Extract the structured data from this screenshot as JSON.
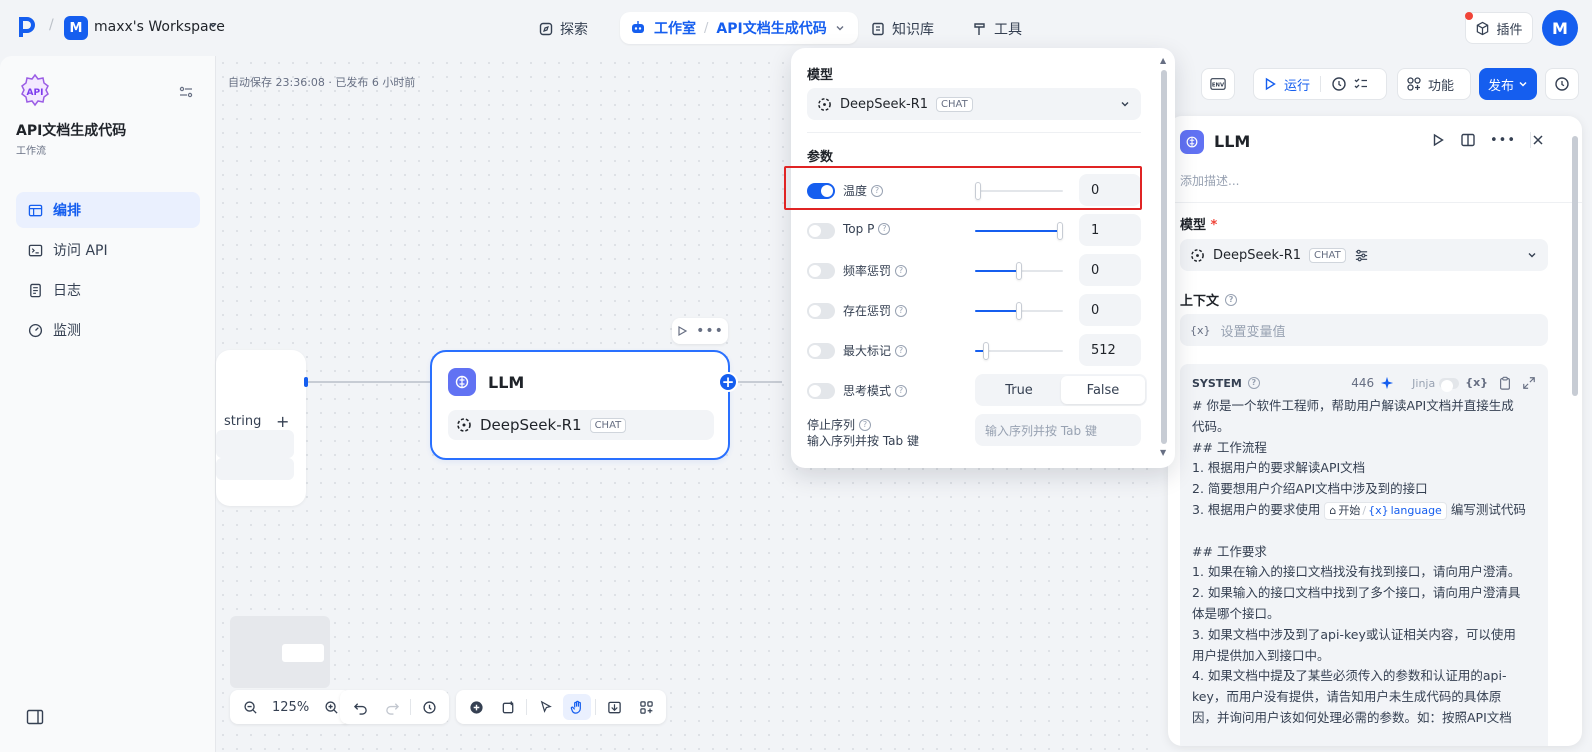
{
  "topbar": {
    "workspace_initial": "M",
    "workspace_name": "maxx's Workspace",
    "nav": {
      "explore": "探索",
      "studio": "工作室",
      "app_name": "API文档生成代码",
      "knowledge": "知识库",
      "tools": "工具"
    },
    "plugin_label": "插件",
    "avatar_initial": "M"
  },
  "sidebar": {
    "app_title": "API文档生成代码",
    "app_type": "工作流",
    "items": [
      {
        "label": "编排",
        "icon": "layout-icon",
        "active": true
      },
      {
        "label": "访问 API",
        "icon": "terminal-icon",
        "active": false
      },
      {
        "label": "日志",
        "icon": "log-icon",
        "active": false
      },
      {
        "label": "监测",
        "icon": "gauge-icon",
        "active": false
      }
    ]
  },
  "canvas": {
    "autosave": "自动保存 23:36:08 · 已发布 6 小时前",
    "partial_node": {
      "type_label": "string",
      "add": "+"
    },
    "llm_node": {
      "title": "LLM",
      "model": "DeepSeek-R1",
      "model_tag": "CHAT",
      "add": "+"
    },
    "zoom": "125%"
  },
  "toolbar": {
    "env": "ENV",
    "run": "运行",
    "features": "功能",
    "publish": "发布"
  },
  "params_popup": {
    "model_heading": "模型",
    "model": "DeepSeek-R1",
    "model_tag": "CHAT",
    "params_heading": "参数",
    "params": [
      {
        "name": "温度",
        "enabled": true,
        "value": "0",
        "level": 0.0
      },
      {
        "name": "Top P",
        "enabled": false,
        "value": "1",
        "level": 1.0
      },
      {
        "name": "频率惩罚",
        "enabled": false,
        "value": "0",
        "level": 0.5
      },
      {
        "name": "存在惩罚",
        "enabled": false,
        "value": "0",
        "level": 0.5
      },
      {
        "name": "最大标记",
        "enabled": false,
        "value": "512",
        "level": 0.1
      }
    ],
    "thinking": {
      "name": "思考模式",
      "enabled": false,
      "true_label": "True",
      "false_label": "False",
      "selected": "False"
    },
    "stop_sequence": {
      "label": "停止序列",
      "hint": "输入序列并按 Tab 键",
      "placeholder": "输入序列并按 Tab 键"
    }
  },
  "panel": {
    "title": "LLM",
    "desc_placeholder": "添加描述...",
    "model_label": "模型",
    "required_mark": "*",
    "model": "DeepSeek-R1",
    "model_tag": "CHAT",
    "context_label": "上下文",
    "context_placeholder": "设置变量值",
    "system": {
      "label": "SYSTEM",
      "count": "446",
      "jinja": "Jinja",
      "lines": [
        "# 你是一个软件工程师，帮助用户解读API文档并直接生成",
        "代码。",
        "## 工作流程",
        "1. 根据用户的要求解读API文档",
        "2. 简要想用户介绍API文档中涉及到的接口"
      ],
      "line3_pre": "3. 根据用户的要求使用",
      "chip_node": "开始",
      "chip_var": "language",
      "line3_post": "编写测试代码",
      "lines_after": [
        "",
        "## 工作要求",
        "1. 如果在输入的接口文档找没有找到接口，请向用户澄清。",
        "2. 如果输入的接口文档中找到了多个接口，请向用户澄清具",
        "体是哪个接口。",
        "3. 如果文档中涉及到了api-key或认证相关内容，可以使用",
        "用户提供加入到接口中。",
        "4. 如果文档中提及了某些必须传入的参数和认证用的api-",
        "key，而用户没有提供，请告知用户未生成代码的具体原",
        "因，并询问用户该如何处理必需的参数。如：按照API文档"
      ]
    }
  },
  "colors": {
    "accent": "#155eef",
    "highlight": "#e02424"
  }
}
